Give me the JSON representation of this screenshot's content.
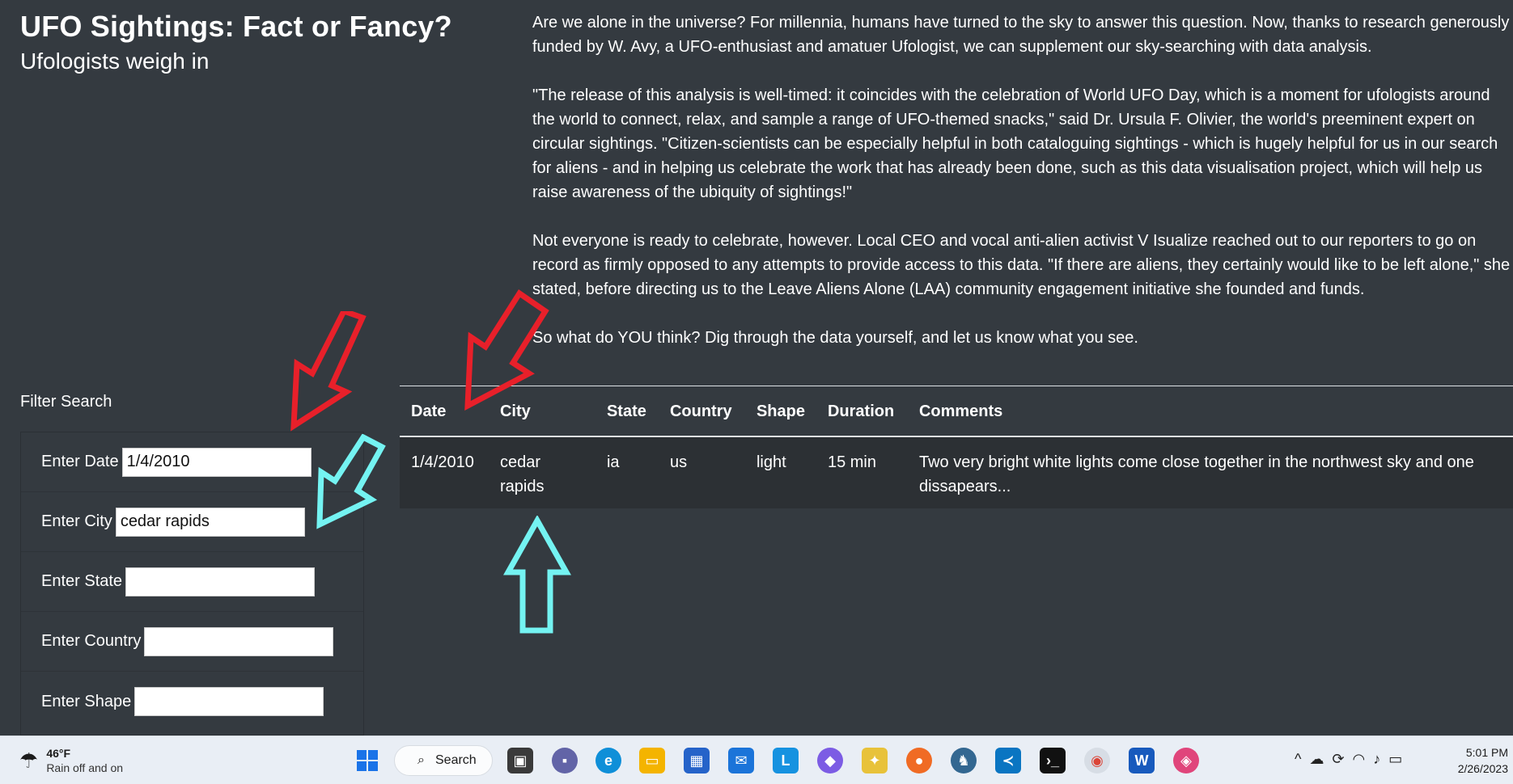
{
  "header": {
    "title": "UFO Sightings: Fact or Fancy?",
    "subtitle": "Ufologists weigh in"
  },
  "article": {
    "paragraphs": [
      "Are we alone in the universe? For millennia, humans have turned to the sky to answer this question. Now, thanks to research generously funded by W. Avy, a UFO-enthusiast and amatuer Ufologist, we can supplement our sky-searching with data analysis.",
      "\"The release of this analysis is well-timed: it coincides with the celebration of World UFO Day, which is a moment for ufologists around the world to connect, relax, and sample a range of UFO-themed snacks,\" said Dr. Ursula F. Olivier, the world's preeminent expert on circular sightings. \"Citizen-scientists can be especially helpful in both cataloguing sightings - which is hugely helpful for us in our search for aliens - and in helping us celebrate the work that has already been done, such as this data visualisation project, which will help us raise awareness of the ubiquity of sightings!\"",
      "Not everyone is ready to celebrate, however. Local CEO and vocal anti-alien activist V Isualize reached out to our reporters to go on record as firmly opposed to any attempts to provide access to this data. \"If there are aliens, they certainly would like to be left alone,\" she stated, before directing us to the Leave Aliens Alone (LAA) community engagement initiative she founded and funds.",
      "So what do YOU think? Dig through the data yourself, and let us know what you see."
    ]
  },
  "filters": {
    "heading": "Filter Search",
    "fields": [
      {
        "label": "Enter Date",
        "value": "1/4/2010"
      },
      {
        "label": "Enter City",
        "value": "cedar rapids"
      },
      {
        "label": "Enter State",
        "value": ""
      },
      {
        "label": "Enter Country",
        "value": ""
      },
      {
        "label": "Enter Shape",
        "value": ""
      }
    ]
  },
  "table": {
    "headers": [
      "Date",
      "City",
      "State",
      "Country",
      "Shape",
      "Duration",
      "Comments"
    ],
    "rows": [
      [
        "1/4/2010",
        "cedar rapids",
        "ia",
        "us",
        "light",
        "15 min",
        "Two very bright white lights come close together in the northwest sky and one dissapears..."
      ]
    ]
  },
  "annotations": {
    "red_arrow_color": "#e8202a",
    "cyan_arrow_color": "#74f3f2",
    "arrows": [
      "red-arrow-date-input",
      "red-arrow-date-column",
      "cyan-arrow-city-input",
      "cyan-arrow-city-cell"
    ]
  },
  "taskbar": {
    "weather_temp": "46°F",
    "weather_condition": "Rain off and on",
    "search_label": "Search",
    "time": "5:01 PM",
    "date": "2/26/2023",
    "word_icon_letter": "W",
    "lynx_icon_letter": "L",
    "icons": [
      "windows-start-icon",
      "search-icon",
      "task-view-icon",
      "teams-chat-icon",
      "edge-icon",
      "file-explorer-icon",
      "store-icon",
      "mail-icon",
      "lynda-icon",
      "copilot-icon",
      "git-kraken-icon",
      "firefox-icon",
      "pgadmin-icon",
      "vscode-icon",
      "terminal-icon",
      "chrome-icon",
      "word-icon",
      "paint-icon"
    ],
    "tray_icons": [
      "chevron-up-icon",
      "cloud-icon",
      "sync-icon",
      "wifi-icon",
      "volume-icon",
      "battery-icon"
    ]
  }
}
